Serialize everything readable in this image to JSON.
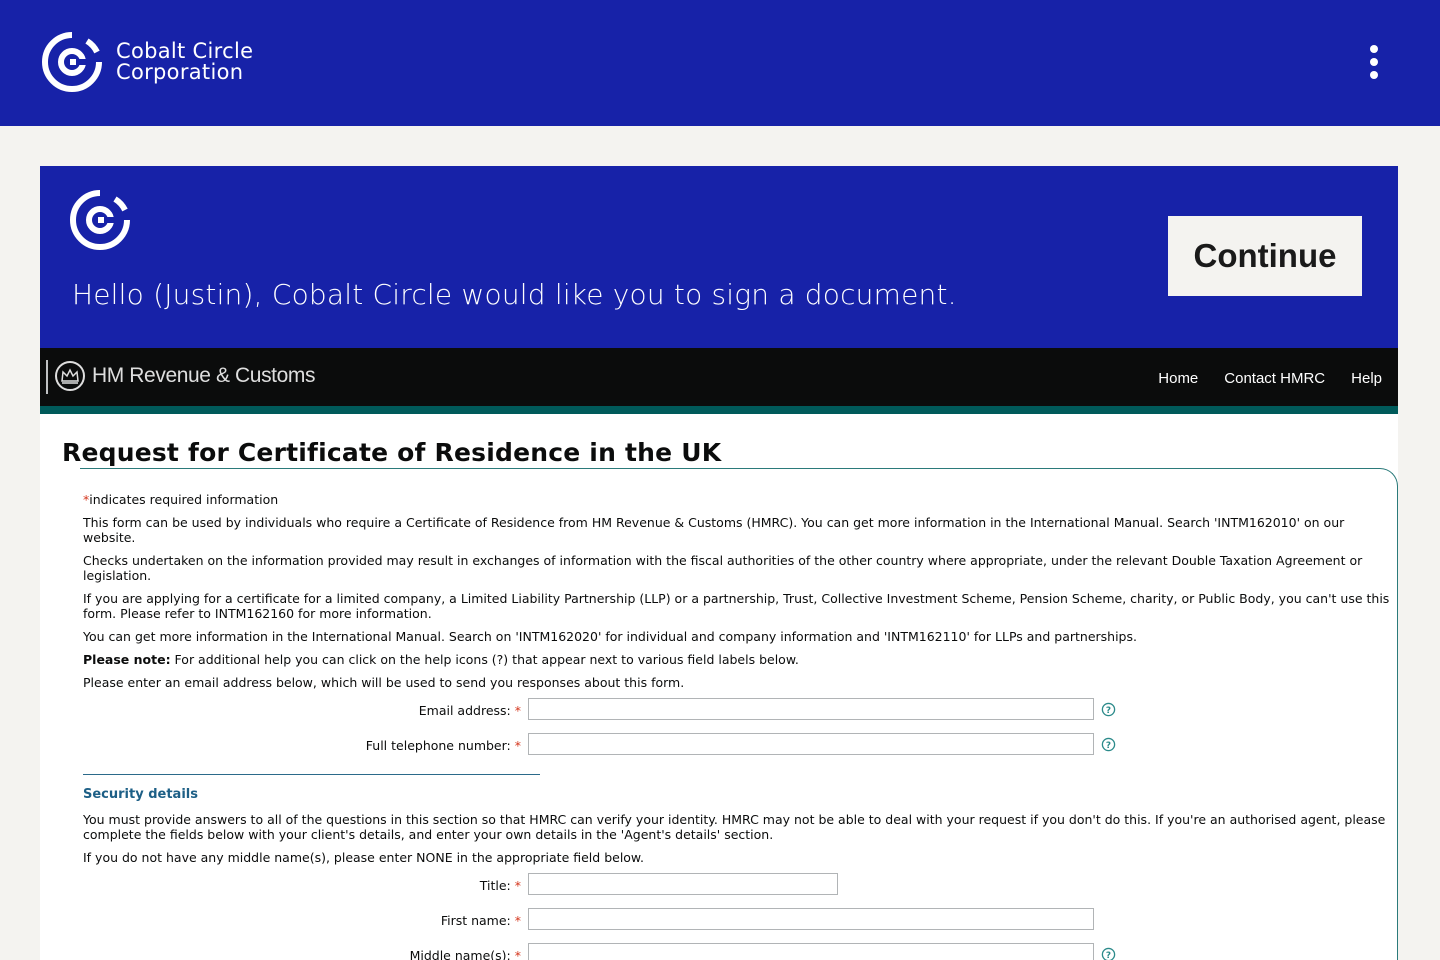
{
  "header": {
    "brand_line1": "Cobalt Circle",
    "brand_line2": "Corporation",
    "logo_icon": "circle-logo-icon",
    "menu_icon": "kebab-menu-icon"
  },
  "banner": {
    "greeting": "Hello (Justin), Cobalt Circle would like you to sign a document.",
    "continue_label": "Continue"
  },
  "hmrc": {
    "site_name": "HM Revenue & Customs",
    "nav": [
      "Home",
      "Contact HMRC",
      "Help"
    ],
    "page_title": "Request for Certificate of Residence in the UK",
    "required_note": "indicates required information",
    "intro": [
      "This form can be used by individuals who require a Certificate of Residence from HM Revenue & Customs (HMRC). You can get more information in the International Manual. Search 'INTM162010' on our website.",
      "Checks undertaken on the information provided may result in exchanges of information with the fiscal authorities of the other country where appropriate, under the relevant Double Taxation Agreement or legislation.",
      "If you are applying for a certificate for a limited company, a Limited Liability Partnership (LLP) or a partnership, Trust, Collective Investment Scheme, Pension Scheme, charity, or Public Body, you can't use this form. Please refer to INTM162160 for more information.",
      "You can get more information in the International Manual. Search on 'INTM162020' for individual and company information and 'INTM162110' for LLPs and partnerships."
    ],
    "please_note_label": "Please note:",
    "please_note_text": " For additional help you can click on the help icons (?) that appear next to various field labels below.",
    "email_intro": "Please enter an email address below, which will be used to send you responses about this form.",
    "email_label": "Email address:",
    "phone_label": "Full telephone number:",
    "security_title": "Security details",
    "security_text": "You must provide answers to all of the questions in this section so that HMRC can verify your identity. HMRC may not be able to deal with your request if you don't do this. If you're an authorised agent, please complete the fields below with your client's details, and enter your own details in the 'Agent's details' section.",
    "middle_name_note": "If you do not have any middle name(s), please enter NONE in the appropriate field below.",
    "title_label": "Title:",
    "first_name_label": "First name:",
    "middle_name_label": "Middle name(s):",
    "required_marker": "*"
  },
  "colors": {
    "brand_blue": "#1722a8",
    "page_bg": "#f4f3f0",
    "hmrc_bar": "#0b0c0c",
    "hmrc_teal": "#005a5a",
    "required_red": "#d4351c"
  }
}
